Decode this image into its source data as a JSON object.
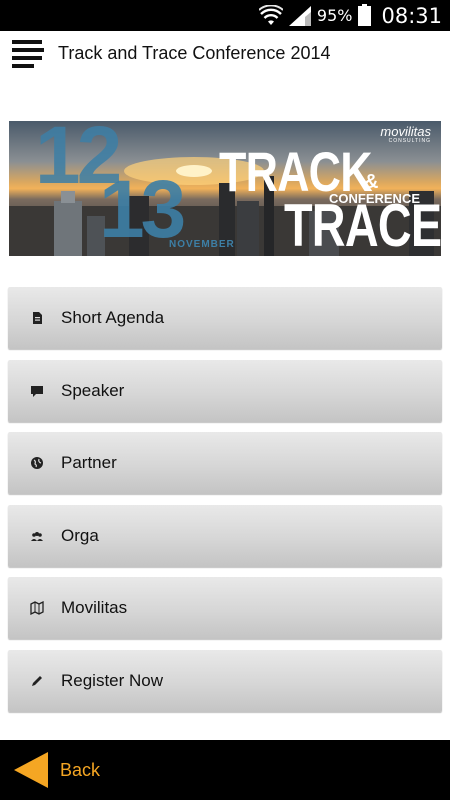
{
  "status_bar": {
    "battery_percent": "95%",
    "time": "08:31"
  },
  "app_bar": {
    "title": "Track and Trace Conference 2014"
  },
  "banner": {
    "date_day1": "12",
    "date_day2": "13",
    "month": "NOVEMBER",
    "brand": "movilitas",
    "brand_sub": "CONSULTING",
    "title_word1": "TRACK",
    "ampersand": "&",
    "conference_word": "CONFERENCE",
    "title_word2": "TRACE"
  },
  "menu": {
    "items": [
      {
        "label": "Short Agenda",
        "icon": "document-icon"
      },
      {
        "label": "Speaker",
        "icon": "chat-icon"
      },
      {
        "label": "Partner",
        "icon": "globe-icon"
      },
      {
        "label": "Orga",
        "icon": "people-icon"
      },
      {
        "label": "Movilitas",
        "icon": "map-icon"
      },
      {
        "label": "Register Now",
        "icon": "pencil-icon"
      }
    ]
  },
  "bottom_bar": {
    "back_label": "Back",
    "accent_color": "#f5a623"
  }
}
